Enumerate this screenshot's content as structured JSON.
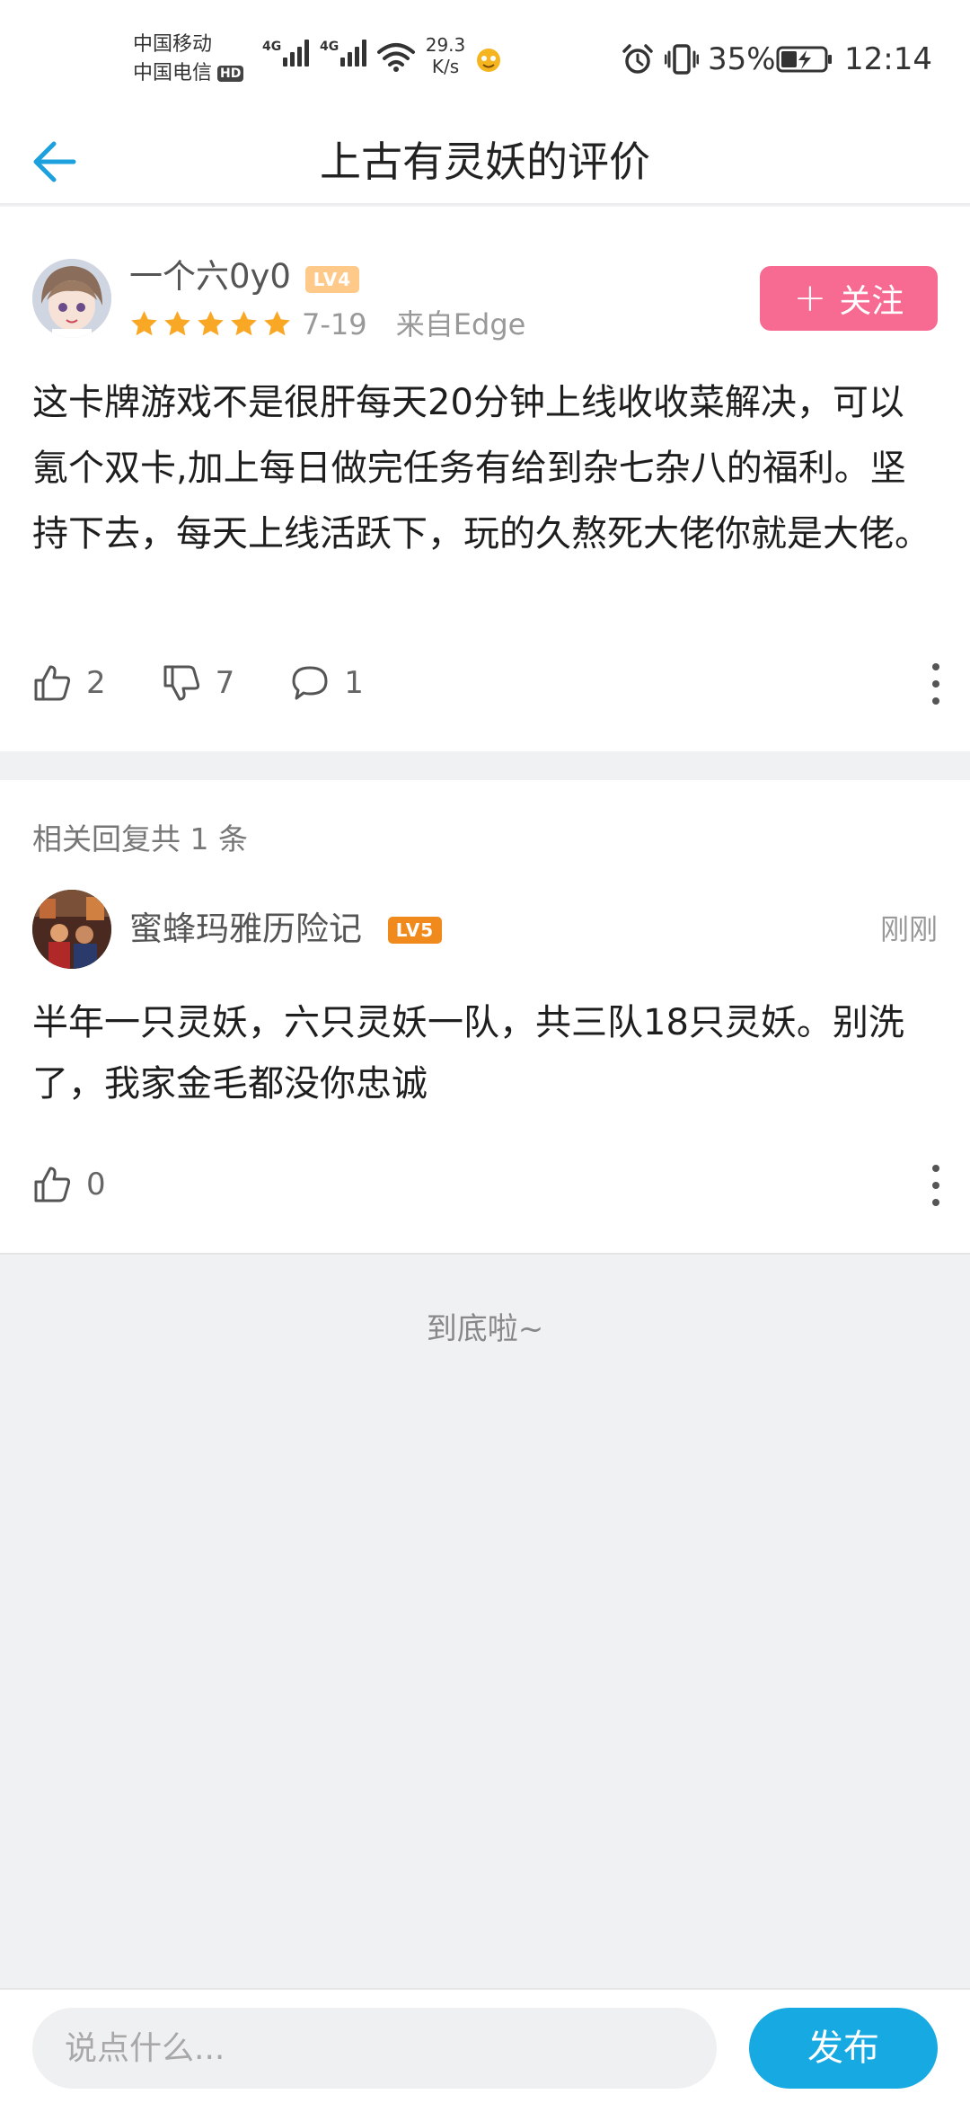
{
  "status_bar": {
    "carrier_1": "中国移动",
    "carrier_2": "中国电信",
    "hd_badge": "HD",
    "network_1": "4G",
    "network_2": "4G",
    "net_speed_value": "29.3",
    "net_speed_unit": "K/s",
    "battery_percent": "35%",
    "time": "12:14"
  },
  "nav": {
    "title": "上古有灵妖的评价"
  },
  "review": {
    "username": "一个六0y0",
    "level": "LV4",
    "rating": 5,
    "date": "7-19",
    "source": "来自Edge",
    "follow_label": "关注",
    "follow_plus": "+",
    "text": "这卡牌游戏不是很肝每天20分钟上线收收菜解决，可以氪个双卡,加上每日做完任务有给到杂七杂八的福利。坚持下去，每天上线活跃下，玩的久熬死大佬你就是大佬。",
    "likes": "2",
    "dislikes": "7",
    "comments": "1"
  },
  "replies": {
    "header": "相关回复共 1 条",
    "items": [
      {
        "username": "蜜蜂玛雅历险记",
        "level": "LV5",
        "time": "刚刚",
        "text": "半年一只灵妖，六只灵妖一队，共三队18只灵妖。别洗了，我家金毛都没你忠诚",
        "likes": "0"
      }
    ]
  },
  "end_text": "到底啦~",
  "bottom_bar": {
    "input_placeholder": "说点什么...",
    "publish_label": "发布"
  },
  "colors": {
    "accent_blue": "#17a9e1",
    "follow_pink": "#f76a91",
    "star_orange": "#f9a825",
    "lv4_badge": "#ffc98a",
    "lv5_badge": "#f08a1c"
  }
}
